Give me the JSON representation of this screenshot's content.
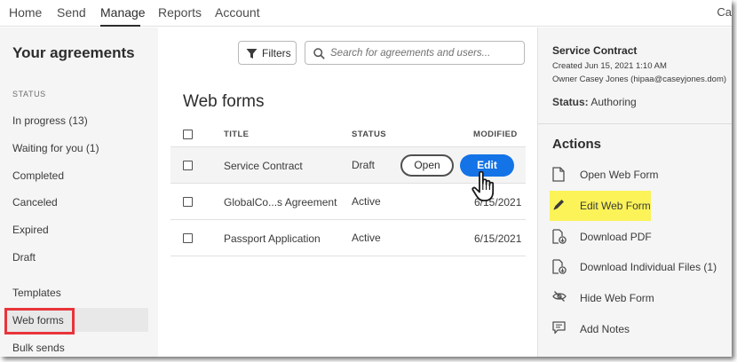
{
  "nav": {
    "items": [
      "Home",
      "Send",
      "Manage",
      "Reports",
      "Account"
    ],
    "active": "Manage",
    "user_initials": "Ca"
  },
  "sidebar": {
    "title": "Your agreements",
    "status_header": "STATUS",
    "items": [
      "In progress (13)",
      "Waiting for you (1)",
      "Completed",
      "Canceled",
      "Expired",
      "Draft",
      "Templates",
      "Web forms",
      "Bulk sends"
    ],
    "selected": "Web forms"
  },
  "toolbar": {
    "filters_label": "Filters",
    "search_placeholder": "Search for agreements and users..."
  },
  "main": {
    "title": "Web forms",
    "columns": [
      "TITLE",
      "STATUS",
      "MODIFIED"
    ],
    "rows": [
      {
        "title": "Service Contract",
        "status": "Draft",
        "modified": ""
      },
      {
        "title": "GlobalCo...s Agreement",
        "status": "Active",
        "modified": "6/15/2021"
      },
      {
        "title": "Passport Application",
        "status": "Active",
        "modified": "6/15/2021"
      }
    ],
    "open_label": "Open",
    "edit_label": "Edit"
  },
  "details": {
    "title": "Service Contract",
    "created": "Created Jun 15, 2021 1:10 AM",
    "owner": "Owner Casey Jones (hipaa@caseyjones.dom)",
    "status_label": "Status:",
    "status_value": "Authoring",
    "actions_header": "Actions",
    "actions": [
      {
        "label": "Open Web Form",
        "icon": "document-icon"
      },
      {
        "label": "Edit Web Form",
        "icon": "pencil-icon"
      },
      {
        "label": "Download PDF",
        "icon": "download-pdf-icon"
      },
      {
        "label": "Download Individual Files (1)",
        "icon": "download-files-icon"
      },
      {
        "label": "Hide Web Form",
        "icon": "eye-slash-icon"
      },
      {
        "label": "Add Notes",
        "icon": "note-icon"
      }
    ],
    "highlighted_action": "Edit Web Form"
  },
  "colors": {
    "accent": "#1473e6",
    "highlight": "#fbf358",
    "selection_outline": "#e8343b"
  }
}
